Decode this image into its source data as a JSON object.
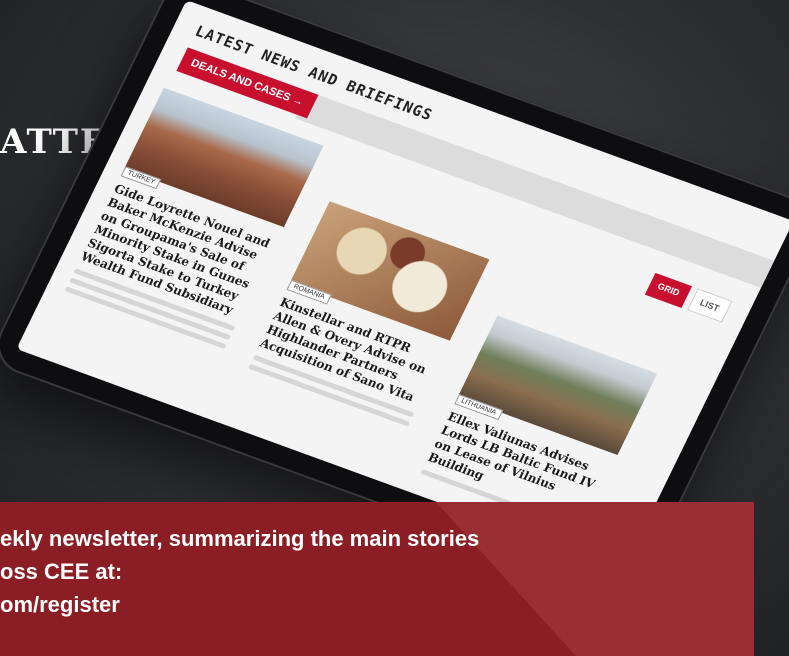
{
  "headline": "ATTERS",
  "tablet": {
    "section_title": "LATEST NEWS AND BRIEFINGS",
    "deals_button": "DEALS AND CASES →",
    "view_toggle": {
      "grid": "GRID",
      "list": "LIST"
    },
    "articles": [
      {
        "country": "TURKEY",
        "title": "Gide Loyrette Nouel and Baker McKenzie Advise on Groupama's Sale of Minority Stake in Gunes Sigorta Stake to Turkey Wealth Fund Subsidiary"
      },
      {
        "country": "ROMANIA",
        "title": "Kinstellar and RTPR Allen & Overy Advise on Highlander Partners Acquisition of Sano Vita"
      },
      {
        "country": "LITHUANIA",
        "title": "Ellex Valiunas Advises Lords LB Baltic Fund IV on Lease of Vilnius Building"
      }
    ]
  },
  "banner": {
    "line1": "ekly newsletter, summarizing the main stories",
    "line2": "oss CEE at:",
    "line3": "om/register"
  },
  "colors": {
    "accent": "#c8102e",
    "banner": "#8b1e24"
  }
}
